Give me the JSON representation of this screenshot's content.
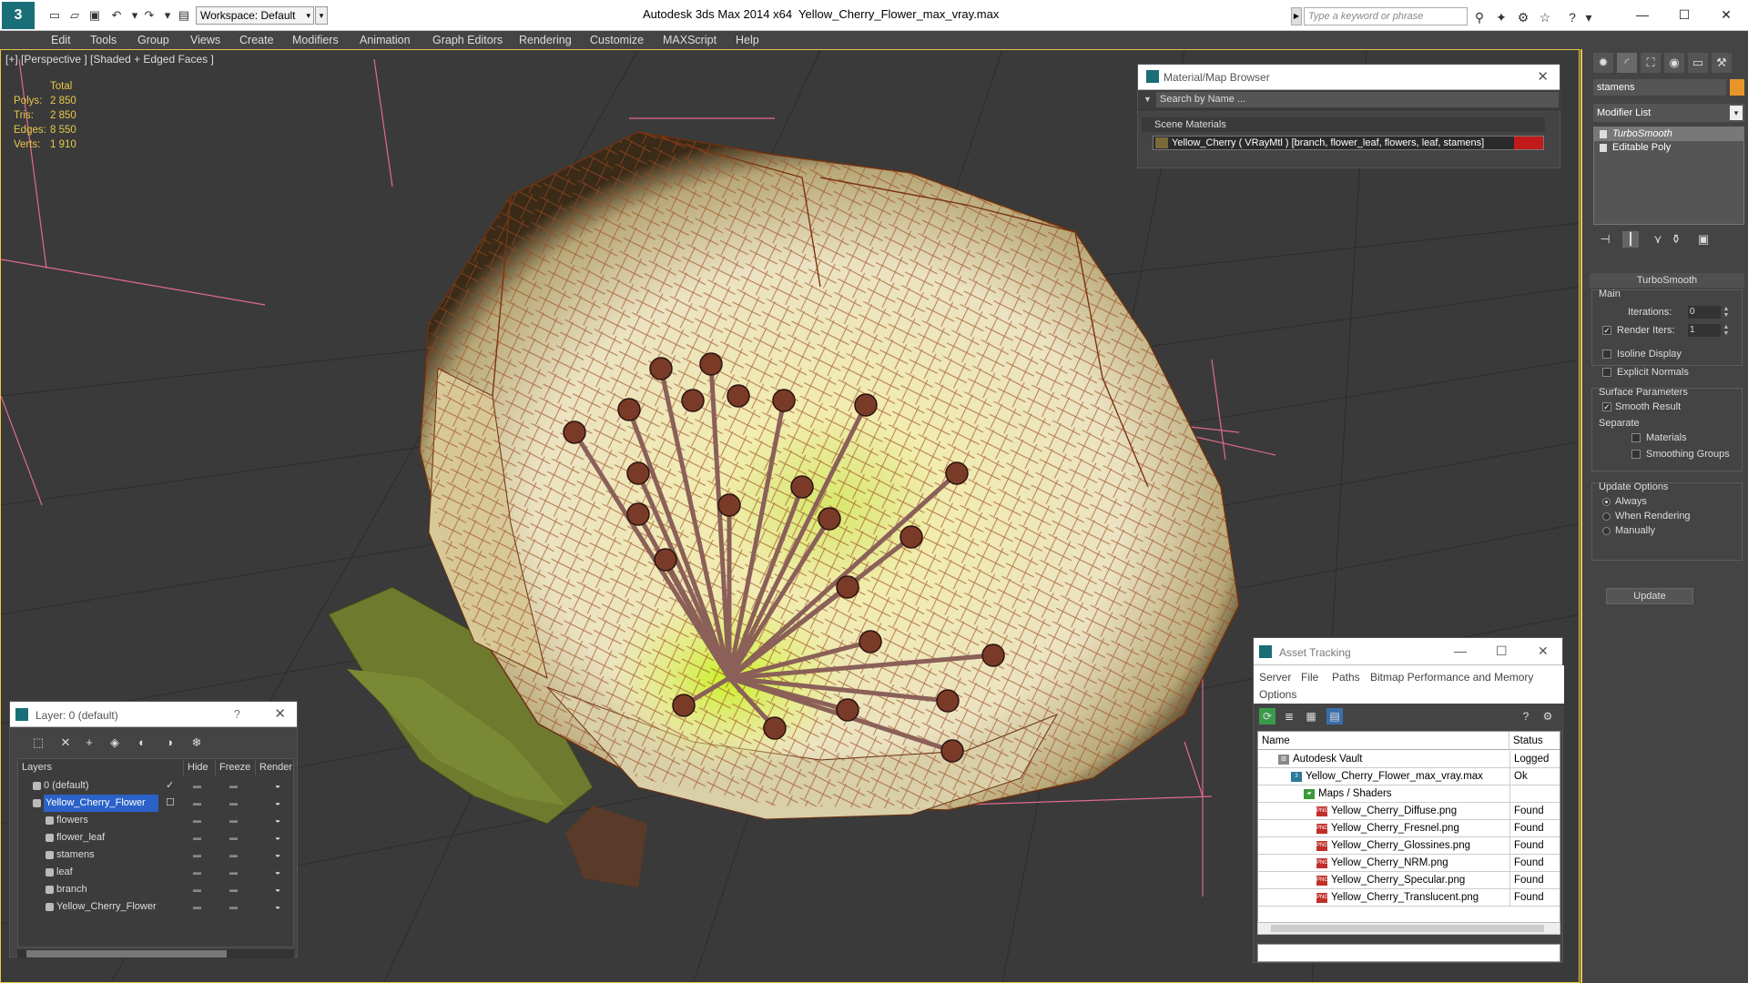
{
  "titlebar": {
    "workspace": "Workspace: Default",
    "app_title": "Autodesk 3ds Max  2014 x64",
    "file_title": "Yellow_Cherry_Flower_max_vray.max",
    "search_placeholder": "Type a keyword or phrase"
  },
  "menu": [
    "Edit",
    "Tools",
    "Group",
    "Views",
    "Create",
    "Modifiers",
    "Animation",
    "Graph Editors",
    "Rendering",
    "Customize",
    "MAXScript",
    "Help"
  ],
  "viewport": {
    "label": "[+] [Perspective ] [Shaded + Edged Faces ]",
    "stats_header": "Total",
    "stats": [
      {
        "label": "Polys:",
        "value": "2 850"
      },
      {
        "label": "Tris:",
        "value": "2 850"
      },
      {
        "label": "Edges:",
        "value": "8 550"
      },
      {
        "label": "Verts:",
        "value": "1 910"
      }
    ]
  },
  "material_browser": {
    "title": "Material/Map Browser",
    "search_placeholder": "Search by Name ...",
    "section": "Scene Materials",
    "material": "Yellow_Cherry  ( VRayMtl )  [branch, flower_leaf, flowers, leaf, stamens]"
  },
  "command_panel": {
    "object_name": "stamens",
    "object_color": "#e8962a",
    "modifier_list": "Modifier List",
    "stack": [
      "TurboSmooth",
      "Editable Poly"
    ],
    "rollout_title": "TurboSmooth",
    "main_label": "Main",
    "iterations_label": "Iterations:",
    "iterations_value": "0",
    "render_iters_label": "Render Iters:",
    "render_iters_value": "1",
    "isoline_display": "Isoline Display",
    "explicit_normals": "Explicit Normals",
    "surface_params": "Surface Parameters",
    "smooth_result": "Smooth Result",
    "separate": "Separate",
    "materials": "Materials",
    "smoothing_groups": "Smoothing Groups",
    "update_options": "Update Options",
    "always": "Always",
    "when_rendering": "When Rendering",
    "manually": "Manually",
    "update_button": "Update"
  },
  "layers": {
    "title": "Layer: 0 (default)",
    "help": "?",
    "columns": [
      "Layers",
      "Hide",
      "Freeze",
      "Render"
    ],
    "rows": [
      {
        "name": "0 (default)",
        "indent": 0,
        "selected": false
      },
      {
        "name": "Yellow_Cherry_Flower",
        "indent": 0,
        "selected": true
      },
      {
        "name": "flowers",
        "indent": 1,
        "selected": false
      },
      {
        "name": "flower_leaf",
        "indent": 1,
        "selected": false
      },
      {
        "name": "stamens",
        "indent": 1,
        "selected": false
      },
      {
        "name": "leaf",
        "indent": 1,
        "selected": false
      },
      {
        "name": "branch",
        "indent": 1,
        "selected": false
      },
      {
        "name": "Yellow_Cherry_Flower",
        "indent": 1,
        "selected": false
      }
    ]
  },
  "asset_tracking": {
    "title": "Asset Tracking",
    "menu": [
      "Server",
      "File",
      "Paths",
      "Bitmap Performance and Memory",
      "Options"
    ],
    "columns": [
      "Name",
      "Status"
    ],
    "rows": [
      {
        "name": "Autodesk Vault",
        "status": "Logged Out",
        "indent": 1,
        "icon": "vault"
      },
      {
        "name": "Yellow_Cherry_Flower_max_vray.max",
        "status": "Ok",
        "indent": 2,
        "icon": "max"
      },
      {
        "name": "Maps / Shaders",
        "status": "",
        "indent": 3,
        "icon": "maps"
      },
      {
        "name": "Yellow_Cherry_Diffuse.png",
        "status": "Found",
        "indent": 4,
        "icon": "png"
      },
      {
        "name": "Yellow_Cherry_Fresnel.png",
        "status": "Found",
        "indent": 4,
        "icon": "png"
      },
      {
        "name": "Yellow_Cherry_Glossines.png",
        "status": "Found",
        "indent": 4,
        "icon": "png"
      },
      {
        "name": "Yellow_Cherry_NRM.png",
        "status": "Found",
        "indent": 4,
        "icon": "png"
      },
      {
        "name": "Yellow_Cherry_Specular.png",
        "status": "Found",
        "indent": 4,
        "icon": "png"
      },
      {
        "name": "Yellow_Cherry_Translucent.png",
        "status": "Found",
        "indent": 4,
        "icon": "png"
      }
    ]
  }
}
